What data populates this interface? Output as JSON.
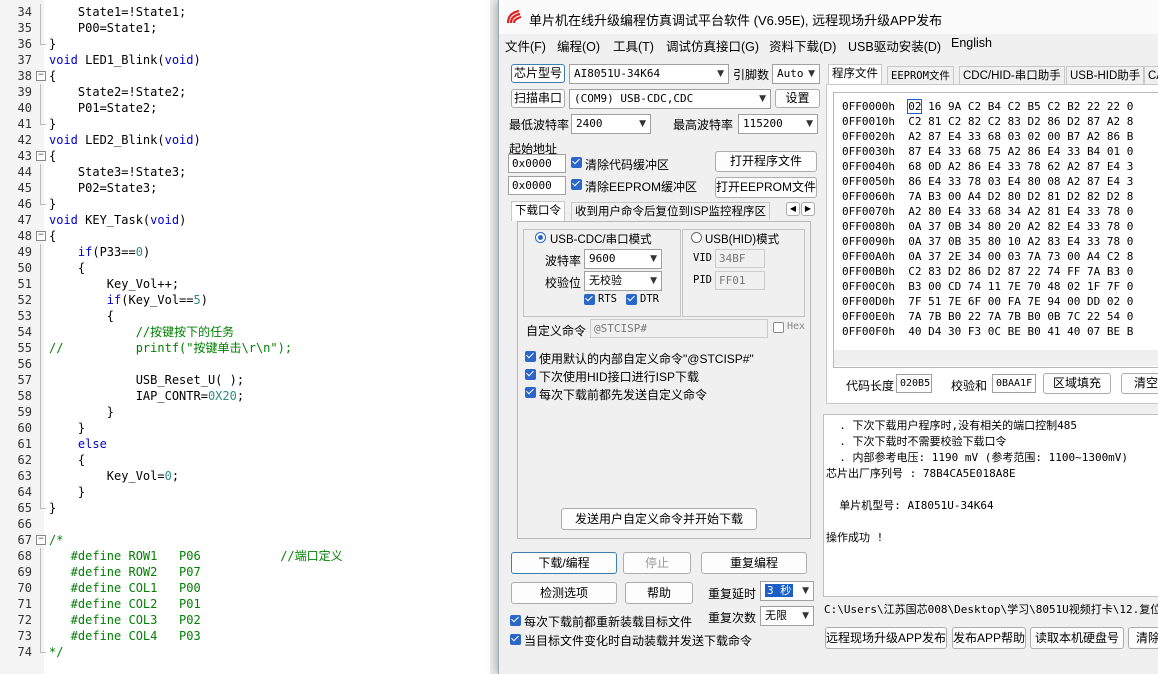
{
  "editor": {
    "lines": [
      {
        "n": "34",
        "t": "    State1=!State1;"
      },
      {
        "n": "35",
        "t": "    P00=State1;"
      },
      {
        "n": "36",
        "t": "}"
      },
      {
        "n": "37",
        "t": "void LED1_Blink(void)"
      },
      {
        "n": "38",
        "t": "{"
      },
      {
        "n": "39",
        "t": "    State2=!State2;"
      },
      {
        "n": "40",
        "t": "    P01=State2;"
      },
      {
        "n": "41",
        "t": "}"
      },
      {
        "n": "42",
        "t": "void LED2_Blink(void)"
      },
      {
        "n": "43",
        "t": "{"
      },
      {
        "n": "44",
        "t": "    State3=!State3;"
      },
      {
        "n": "45",
        "t": "    P02=State3;"
      },
      {
        "n": "46",
        "t": "}"
      },
      {
        "n": "47",
        "t": "void KEY_Task(void)"
      },
      {
        "n": "48",
        "t": "{"
      },
      {
        "n": "49",
        "t": "    if(P33==0)"
      },
      {
        "n": "50",
        "t": "    {"
      },
      {
        "n": "51",
        "t": "        Key_Vol++;"
      },
      {
        "n": "52",
        "t": "        if(Key_Vol==5)"
      },
      {
        "n": "53",
        "t": "        {"
      },
      {
        "n": "54",
        "t": "            //按键按下的任务"
      },
      {
        "n": "55",
        "t": "//          printf(\"按键单击\\r\\n\");"
      },
      {
        "n": "56",
        "t": ""
      },
      {
        "n": "57",
        "t": "            USB_Reset_U( );"
      },
      {
        "n": "58",
        "t": "            IAP_CONTR=0X20;"
      },
      {
        "n": "59",
        "t": "        }"
      },
      {
        "n": "60",
        "t": "    }"
      },
      {
        "n": "61",
        "t": "    else"
      },
      {
        "n": "62",
        "t": "    {"
      },
      {
        "n": "63",
        "t": "        Key_Vol=0;"
      },
      {
        "n": "64",
        "t": "    }"
      },
      {
        "n": "65",
        "t": "}"
      },
      {
        "n": "66",
        "t": ""
      },
      {
        "n": "67",
        "t": "/*"
      },
      {
        "n": "68",
        "t": "   #define ROW1   P06           //端口定义"
      },
      {
        "n": "69",
        "t": "   #define ROW2   P07"
      },
      {
        "n": "70",
        "t": "   #define COL1   P00"
      },
      {
        "n": "71",
        "t": "   #define COL2   P01"
      },
      {
        "n": "72",
        "t": "   #define COL3   P02"
      },
      {
        "n": "73",
        "t": "   #define COL4   P03"
      },
      {
        "n": "74",
        "t": "*/"
      }
    ]
  },
  "window": {
    "title": "单片机在线升级编程仿真调试平台软件 (V6.95E), 远程现场升级APP发布",
    "menu": [
      "文件(F)",
      "编程(O)",
      "工具(T)",
      "调试仿真接口(G)",
      "资料下载(D)",
      "USB驱动安装(D)",
      "English"
    ]
  },
  "left": {
    "chip_label": "芯片型号",
    "chip_value": "AI8051U-34K64",
    "pin_label": "引脚数",
    "pin_value": "Auto",
    "scan_label": "扫描串口",
    "port_value": "(COM9) USB-CDC,CDC",
    "settings_label": "设置",
    "min_baud_label": "最低波特率",
    "min_baud_value": "2400",
    "max_baud_label": "最高波特率",
    "max_baud_value": "115200",
    "start_addr_label": "起始地址",
    "addr1": "0x0000",
    "clear_code_label": "清除代码缓冲区",
    "open_program_label": "打开程序文件",
    "addr2": "0x0000",
    "clear_eeprom_label": "清除EEPROM缓冲区",
    "open_eeprom_label": "打开EEPROM文件",
    "tab_download": "下载口令",
    "tab_isp": "收到用户命令后复位到ISP监控程序区",
    "mode_cdc": "USB-CDC/串口模式",
    "mode_hid": "USB(HID)模式",
    "baud_label": "波特率",
    "baud_value": "9600",
    "parity_label": "校验位",
    "parity_value": "无校验",
    "rts": "RTS",
    "dtr": "DTR",
    "vid_label": "VID",
    "vid_value": "34BF",
    "pid_label": "PID",
    "pid_value": "FF01",
    "custom_cmd_label": "自定义命令",
    "custom_cmd_value": "@STCISP#",
    "hex_label": "Hex",
    "opt1": "使用默认的内部自定义命令\"@STCISP#\"",
    "opt2": "下次使用HID接口进行ISP下载",
    "opt3": "每次下载前都先发送自定义命令",
    "send_cmd_label": "发送用户自定义命令并开始下载",
    "download_label": "下载/编程",
    "stop_label": "停止",
    "reprogram_label": "重复编程",
    "detect_label": "检测选项",
    "help_label": "帮助",
    "repeat_delay_label": "重复延时",
    "repeat_delay_value": "3 秒",
    "repeat_count_label": "重复次数",
    "repeat_count_value": "无限",
    "reload_label": "每次下载前都重新装载目标文件",
    "auto_label": "当目标文件变化时自动装载并发送下载命令"
  },
  "right": {
    "tabs": [
      "程序文件",
      "EEPROM文件",
      "CDC/HID-串口助手",
      "USB-HID助手",
      "CA"
    ],
    "hex_rows": [
      {
        "addr": "0FF0000h",
        "first": "02",
        "rest": " 16 9A C2 B4 C2 B5 C2 B2 22 22 0"
      },
      {
        "addr": "0FF0010h",
        "first": "C2",
        "rest": " 81 C2 82 C2 83 D2 86 D2 87 A2 8"
      },
      {
        "addr": "0FF0020h",
        "first": "A2",
        "rest": " 87 E4 33 68 03 02 00 B7 A2 86 B"
      },
      {
        "addr": "0FF0030h",
        "first": "87",
        "rest": " E4 33 68 75 A2 86 E4 33 B4 01 0"
      },
      {
        "addr": "0FF0040h",
        "first": "68",
        "rest": " 0D A2 86 E4 33 78 62 A2 87 E4 3"
      },
      {
        "addr": "0FF0050h",
        "first": "86",
        "rest": " E4 33 78 03 E4 80 08 A2 87 E4 3"
      },
      {
        "addr": "0FF0060h",
        "first": "7A",
        "rest": " B3 00 A4 D2 80 D2 81 D2 82 D2 8"
      },
      {
        "addr": "0FF0070h",
        "first": "A2",
        "rest": " 80 E4 33 68 34 A2 81 E4 33 78 0"
      },
      {
        "addr": "0FF0080h",
        "first": "0A",
        "rest": " 37 0B 34 80 20 A2 82 E4 33 78 0"
      },
      {
        "addr": "0FF0090h",
        "first": "0A",
        "rest": " 37 0B 35 80 10 A2 83 E4 33 78 0"
      },
      {
        "addr": "0FF00A0h",
        "first": "0A",
        "rest": " 37 2E 34 00 03 7A 73 00 A4 C2 8"
      },
      {
        "addr": "0FF00B0h",
        "first": "C2",
        "rest": " 83 D2 86 D2 87 22 74 FF 7A B3 0"
      },
      {
        "addr": "0FF00C0h",
        "first": "B3",
        "rest": " 00 CD 74 11 7E 70 48 02 1F 7F 0"
      },
      {
        "addr": "0FF00D0h",
        "first": "7F",
        "rest": " 51 7E 6F 00 FA 7E 94 00 DD 02 0"
      },
      {
        "addr": "0FF00E0h",
        "first": "7A",
        "rest": " 7B B0 22 7A 7B B0 0B 7C 22 54 0"
      },
      {
        "addr": "0FF00F0h",
        "first": "40",
        "rest": " D4 30 F3 0C BE B0 41 40 07 BE B"
      }
    ],
    "code_len_label": "代码长度",
    "code_len_value": "020B5",
    "checksum_label": "校验和",
    "checksum_value": "0BAA1F",
    "fill_label": "区域填充",
    "clear_label": "清空",
    "log_lines": [
      "  . 下次下载用户程序时,没有相关的端口控制485",
      "  . 下次下载时不需要校验下载口令",
      "  . 内部参考电压: 1190 mV (参考范围: 1100~1300mV)",
      "芯片出厂序列号 : 78B4CA5E018A8E",
      "",
      "  单片机型号: AI8051U-34K64",
      "",
      "操作成功 !"
    ],
    "path": "C:\\Users\\江苏国芯008\\Desktop\\学习\\8051U视频打卡\\12.复位",
    "publish_label": "远程现场升级APP发布",
    "publish_help_label": "发布APP帮助",
    "read_disk_label": "读取本机硬盘号",
    "clear2_label": "清除"
  }
}
